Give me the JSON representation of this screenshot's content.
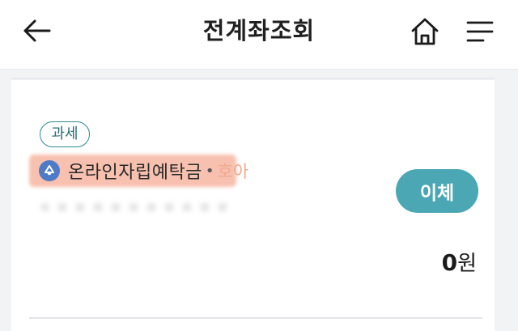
{
  "header": {
    "title": "전계좌조회",
    "icons": {
      "back": "back-arrow-icon",
      "home": "home-icon",
      "menu": "hamburger-menu-icon"
    }
  },
  "account": {
    "tax_badge": "과세",
    "icon": "product-icon",
    "name": "온라인자립예탁금",
    "separator": "•",
    "name_tail": "호아",
    "transfer_label": "이체",
    "balance": "0",
    "balance_unit": "원"
  },
  "colors": {
    "accent": "#4ba7b4",
    "badge_border": "#2d8a92",
    "highlight": "#f08c6e",
    "icon_bg": "#4e7bc8"
  }
}
